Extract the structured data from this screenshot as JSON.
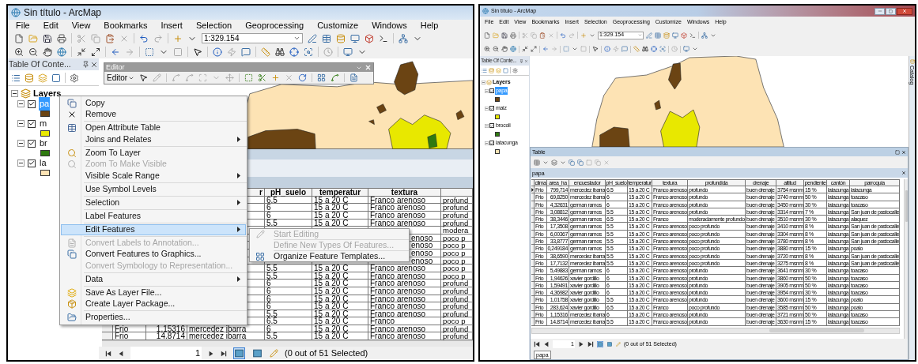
{
  "left_window": {
    "title": "Sin título - ArcMap",
    "menu": [
      "File",
      "Edit",
      "View",
      "Bookmarks",
      "Insert",
      "Selection",
      "Geoprocessing",
      "Customize",
      "Windows",
      "Help"
    ],
    "scale": "1:329.154",
    "toc": {
      "title": "Table Of Conte...",
      "root": "Layers",
      "layers": [
        {
          "label": "pa",
          "selected": true,
          "checked": true,
          "color": "#6b4413"
        },
        {
          "label": "m",
          "selected": false,
          "checked": true,
          "color": "#e8e800"
        },
        {
          "label": "br",
          "selected": false,
          "checked": true,
          "color": "#2f7a10"
        },
        {
          "label": "la",
          "selected": false,
          "checked": true,
          "color": "#fde3b4"
        }
      ]
    },
    "editor_toolbar": {
      "title": "Editor",
      "menu_button": "Editor"
    },
    "table": {
      "columns": [
        {},
        {},
        {
          "label": "r"
        },
        {
          "label": "pH_suelo"
        },
        {
          "label": "temperatur"
        },
        {
          "label": "textura"
        },
        {}
      ],
      "rows": [
        [
          null,
          null,
          null,
          "6.5",
          "15 a 20 C",
          "Franco arenoso",
          "profund"
        ],
        [
          null,
          null,
          null,
          "6",
          "15 a 20 C",
          "Franco arenoso",
          "profund"
        ],
        [
          null,
          null,
          null,
          "6",
          "15 a 20 C",
          "Franco arenoso",
          "profund"
        ],
        [
          null,
          null,
          null,
          "5.5",
          "15 a 20 C",
          "Franco arenoso",
          "profund"
        ],
        [
          null,
          null,
          null,
          null,
          null,
          null,
          "modera"
        ],
        [
          null,
          null,
          null,
          null,
          null,
          {
            "text": "enoso",
            "kind": "tail"
          },
          "poco p"
        ],
        [
          null,
          null,
          null,
          null,
          null,
          {
            "text": "enoso",
            "kind": "tail"
          },
          "poco p"
        ],
        [
          null,
          null,
          null,
          null,
          null,
          {
            "text": "enoso",
            "kind": "tail"
          },
          "poco p"
        ],
        [
          null,
          null,
          null,
          null,
          null,
          {
            "text": "enoso",
            "kind": "tail"
          },
          "poco p"
        ],
        [
          null,
          null,
          null,
          "5.5",
          "15 a 20 C",
          "Franco arenoso",
          "poco p"
        ],
        [
          null,
          null,
          null,
          "5.5",
          "15 a 20 C",
          "Franco arenoso",
          "poco p"
        ],
        [
          null,
          null,
          null,
          "6",
          "15 a 20 C",
          "Franco arenoso",
          "profund"
        ],
        [
          null,
          null,
          null,
          "6",
          "15 a 20 C",
          "Franco arenoso",
          "profund"
        ],
        [
          null,
          null,
          null,
          "6",
          "15 a 20 C",
          "Franco arenoso",
          "profund"
        ],
        [
          null,
          null,
          null,
          "6",
          "15 a 20 C",
          "Franco arenoso",
          "profund"
        ],
        [
          null,
          null,
          null,
          "5.5",
          "15 a 20 C",
          "Franco arenoso",
          "profund"
        ],
        [
          null,
          null,
          null,
          "6.5",
          "15 a 20 C",
          "Franco",
          "poco p"
        ],
        [
          "Frio",
          "1,15316",
          "mercedez ibarra",
          "6",
          "15 a 20 C",
          "Franco arenoso",
          "profund"
        ],
        [
          "Frio",
          "14.8714",
          "mercedez ibarra",
          "5.5",
          "15 a 20 C",
          "Franco arenoso",
          "profund"
        ]
      ]
    },
    "nav": {
      "page": "1",
      "status": "(0 out of 51 Selected)",
      "views": [
        {
          "selected": true
        },
        {
          "selected": false
        }
      ]
    },
    "context_menu": {
      "items": [
        {
          "label": "Copy",
          "disabled": false,
          "submenu": false,
          "selected": false
        },
        {
          "label": "Remove",
          "disabled": false,
          "submenu": false,
          "selected": false,
          "separator_after": true
        },
        {
          "label": "Open Attribute Table",
          "disabled": false,
          "submenu": false,
          "selected": false
        },
        {
          "label": "Joins and Relates",
          "disabled": false,
          "submenu": true,
          "selected": false,
          "separator_after": true
        },
        {
          "label": "Zoom To Layer",
          "disabled": false,
          "submenu": false,
          "selected": false
        },
        {
          "label": "Zoom To Make Visible",
          "disabled": true,
          "submenu": false,
          "selected": false
        },
        {
          "label": "Visible Scale Range",
          "disabled": false,
          "submenu": true,
          "selected": false,
          "separator_after": true
        },
        {
          "label": "Use Symbol Levels",
          "disabled": false,
          "submenu": false,
          "selected": false,
          "separator_after": true
        },
        {
          "label": "Selection",
          "disabled": false,
          "submenu": true,
          "selected": false,
          "separator_after": true
        },
        {
          "label": "Label Features",
          "disabled": false,
          "submenu": false,
          "selected": false,
          "separator_after": true
        },
        {
          "label": "Edit Features",
          "disabled": false,
          "submenu": true,
          "selected": true,
          "separator_after": true
        },
        {
          "label": "Convert Labels to Annotation...",
          "disabled": true,
          "submenu": false,
          "selected": false
        },
        {
          "label": "Convert Features to Graphics...",
          "disabled": false,
          "submenu": false,
          "selected": false
        },
        {
          "label": "Convert Symbology to Representation...",
          "disabled": true,
          "submenu": false,
          "selected": false,
          "separator_after": true
        },
        {
          "label": "Data",
          "disabled": false,
          "submenu": true,
          "selected": false,
          "separator_after": true
        },
        {
          "label": "Save As Layer File...",
          "disabled": false,
          "submenu": false,
          "selected": false
        },
        {
          "label": "Create Layer Package...",
          "disabled": false,
          "submenu": false,
          "selected": false,
          "separator_after": true
        },
        {
          "label": "Properties...",
          "disabled": false,
          "submenu": false,
          "selected": false
        }
      ]
    },
    "submenu": {
      "items": [
        {
          "label": "Start Editing",
          "disabled": true,
          "separator_after": true
        },
        {
          "label": "Define New Types Of Features...",
          "disabled": true,
          "separator_after": true
        },
        {
          "label": "Organize Feature Templates...",
          "disabled": false
        }
      ]
    }
  },
  "right_window": {
    "title": "Sin título - ArcMap",
    "menu": [
      "File",
      "Edit",
      "View",
      "Bookmarks",
      "Insert",
      "Selection",
      "Geoprocessing",
      "Customize",
      "Windows",
      "Help"
    ],
    "scale": "1:329.154",
    "toc": {
      "title": "Table Of Conte...",
      "root": "Layers",
      "layers": [
        {
          "label": "papa",
          "selected": true,
          "checked": true,
          "color": "#6b4413"
        },
        {
          "label": "maiz",
          "selected": false,
          "checked": true,
          "color": "#e8e800"
        },
        {
          "label": "brocoli",
          "selected": false,
          "checked": true,
          "color": "#2f7a10"
        },
        {
          "label": "latacunga",
          "selected": false,
          "checked": true,
          "color": "#fde3b4"
        }
      ]
    },
    "catalog_tab": "Catalog",
    "table_window": {
      "title": "Table",
      "tab": "papa",
      "columns": [
        "clima",
        "area_ha",
        "encuestador",
        "pH_suelo",
        "temperatur",
        "textura",
        "profundida",
        "drenaje",
        "altitud",
        "pendiente",
        "cantón",
        "parroquia"
      ],
      "rows": [
        {
          "current": true,
          "cells": [
            "Frio",
            "799,714",
            "mercedez ibarra",
            "6.5",
            "15 a 20 C",
            "Franco arenoso",
            "profundo",
            "buen drenaje",
            "3754 msnm",
            "15 %",
            "latacunga",
            "latacunga"
          ]
        },
        {
          "current": false,
          "cells": [
            "Frio",
            "69,8250",
            "mercedez ibarra",
            "6",
            "15 a 20 C",
            "Franco arenoso",
            "profundo",
            "buen drenaje",
            "3740 msnm",
            "50 %",
            "latacunga",
            "toacaso"
          ]
        },
        {
          "current": false,
          "cells": [
            "Frio",
            "4,32631",
            "german ramos",
            "6",
            "15 a 20 C",
            "Franco arenoso",
            "profundo",
            "buen drenaje",
            "3450 msnm",
            "30 %",
            "latacunga",
            "toacaso"
          ]
        },
        {
          "current": false,
          "cells": [
            "Frio",
            "3,08812",
            "german ramos",
            "5.5",
            "15 a 20 C",
            "Franco arenoso",
            "profundo",
            "buen drenaje",
            "3314 msnm",
            "7 %",
            "latacunga",
            "San juan de pastocalle"
          ]
        },
        {
          "current": false,
          "cells": [
            "Frio",
            "38,3446",
            "german ramos",
            "6.5",
            "15 a 20 C",
            "Franco",
            "moderadamente profundo",
            "buen drenaje",
            "3510 msnm",
            "30 %",
            "latacunga",
            "alaquez"
          ]
        },
        {
          "current": false,
          "cells": [
            "Frio",
            "17,3508",
            "german ramos",
            "5.5",
            "15 a 20 C",
            "Franco arenoso",
            "poco profundo",
            "buen drenaje",
            "3410 msnm",
            "8 %",
            "latacunga",
            "San juan de pastocalle"
          ]
        },
        {
          "current": false,
          "cells": [
            "Frio",
            "6,00367",
            "german ramos",
            "5.5",
            "15 a 20 C",
            "Franco arenoso",
            "poco profundo",
            "buen drenaje",
            "3304 msnm",
            "8 %",
            "latacunga",
            "San juan de pastocalle"
          ]
        },
        {
          "current": false,
          "cells": [
            "Frio",
            "33,8777",
            "german ramos",
            "5.5",
            "15 a 20 C",
            "Franco arenoso",
            "poco profundo",
            "buen drenaje",
            "3780 msnm",
            "8 %",
            "latacunga",
            "San juan de pastocalle"
          ]
        },
        {
          "current": false,
          "cells": [
            "Frio",
            "0,249184",
            "german ramos",
            "5.5",
            "15 a 20 C",
            "Franco arenoso",
            "poco profundo",
            "buen drenaje",
            "3880 msnm",
            "15 %",
            "latacunga",
            "poalo"
          ]
        },
        {
          "current": false,
          "cells": [
            "Frio",
            "38,6590",
            "mercedez ibarra",
            "5.5",
            "15 a 20 C",
            "Franco arenoso",
            "poco profundo",
            "buen drenaje",
            "3720 msnm",
            "8 %",
            "latacunga",
            "San juan de pastocalle"
          ]
        },
        {
          "current": false,
          "cells": [
            "Frio",
            "17,7132",
            "mercedez ibarra",
            "5.5",
            "15 a 20 C",
            "Franco arenoso",
            "poco profundo",
            "buen drenaje",
            "3275 msnm",
            "8 %",
            "latacunga",
            "San juan de pastocalle"
          ]
        },
        {
          "current": false,
          "cells": [
            "Frio",
            "5,49883",
            "german ramos",
            "6",
            "15 a 20 C",
            "Franco arenoso",
            "profundo",
            "buen drenaje",
            "3641 msnm",
            "30 %",
            "latacunga",
            "toacaso"
          ]
        },
        {
          "current": false,
          "cells": [
            "Frio",
            "1,94626",
            "xavier gordillo",
            "6",
            "15 a 20 C",
            "Franco arenoso",
            "profundo",
            "buen drenaje",
            "3860 msnm",
            "50 %",
            "latacunga",
            "toacaso"
          ]
        },
        {
          "current": false,
          "cells": [
            "Frio",
            "1,59491",
            "xavier gordillo",
            "6",
            "15 a 20 C",
            "Franco arenoso",
            "profundo",
            "buen drenaje",
            "3905 msnm",
            "50 %",
            "latacunga",
            "toacaso"
          ]
        },
        {
          "current": false,
          "cells": [
            "Frio",
            "4,36982",
            "xavier gordillo",
            "6",
            "15 a 20 C",
            "Franco arenoso",
            "profundo",
            "buen drenaje",
            "3954 msnm",
            "30 %",
            "latacunga",
            "toacaso"
          ]
        },
        {
          "current": false,
          "cells": [
            "Frio",
            "1,01758",
            "xavier gordillo",
            "5.5",
            "15 a 20 C",
            "Franco arenoso",
            "profundo",
            "buen drenaje",
            "3600 msnm",
            "15 %",
            "latacunga",
            "poalo"
          ]
        },
        {
          "current": false,
          "cells": [
            "Frio",
            "283,624",
            "xavier gordillo",
            "6.5",
            "15 a 20 C",
            "Franco",
            "poco profundo",
            "buen drenaje",
            "3585 msnm",
            "50 %",
            "latacunga",
            "poalo"
          ]
        },
        {
          "current": false,
          "cells": [
            "Frio",
            "1,15316",
            "mercedez ibarra",
            "6",
            "15 a 20 C",
            "Franco arenoso",
            "profundo",
            "buen drenaje",
            "3721 msnm",
            "50 %",
            "latacunga",
            "toacaso"
          ]
        },
        {
          "current": false,
          "cells": [
            "Frio",
            "14.8714",
            "mercedez ibarra",
            "5.5",
            "15 a 20 C",
            "Franco arenoso",
            "profundo",
            "buen drenaje",
            "3630 msnm",
            "15 %",
            "latacunga",
            "toacaso"
          ]
        }
      ],
      "page": "1",
      "status": "(0 out of 51 Selected)",
      "views": [
        {
          "selected": true
        },
        {
          "selected": false
        }
      ],
      "bottom_tab": "papa"
    }
  }
}
